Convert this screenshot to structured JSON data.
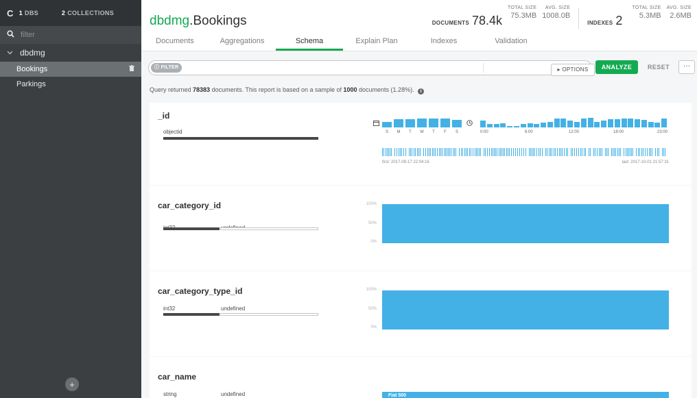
{
  "sidebar": {
    "db_count": "1",
    "db_label": "DBS",
    "coll_count": "2",
    "coll_label": "COLLECTIONS",
    "filter_placeholder": "filter",
    "database": "dbdmg",
    "collections": [
      {
        "name": "Bookings",
        "active": true
      },
      {
        "name": "Parkings",
        "active": false
      }
    ]
  },
  "header": {
    "db": "dbdmg",
    "collection": ".Bookings",
    "documents_label": "DOCUMENTS",
    "documents_value": "78.4k",
    "doc_total_size_label": "TOTAL SIZE",
    "doc_total_size": "75.3MB",
    "doc_avg_size_label": "AVG. SIZE",
    "doc_avg_size": "1008.0B",
    "indexes_label": "INDEXES",
    "indexes_value": "2",
    "idx_total_size_label": "TOTAL SIZE",
    "idx_total_size": "5.3MB",
    "idx_avg_size_label": "AVG. SIZE",
    "idx_avg_size": "2.6MB"
  },
  "tabs": [
    {
      "label": "Documents",
      "active": false
    },
    {
      "label": "Aggregations",
      "active": false
    },
    {
      "label": "Schema",
      "active": true
    },
    {
      "label": "Explain Plan",
      "active": false
    },
    {
      "label": "Indexes",
      "active": false
    },
    {
      "label": "Validation",
      "active": false
    }
  ],
  "querybar": {
    "filter_label": "FILTER",
    "options_label": "▸ OPTIONS",
    "analyze_label": "ANALYZE",
    "reset_label": "RESET",
    "more_label": "···"
  },
  "query_info": {
    "prefix": "Query returned ",
    "count": "78383",
    "middle": " documents. This report is based on a sample of ",
    "sample": "1000",
    "suffix": " documents (1.28%)."
  },
  "fields": [
    {
      "name": "_id",
      "types": [
        {
          "label": "objectid",
          "probability": 1.0
        }
      ],
      "day_labels": [
        "S",
        "M",
        "T",
        "W",
        "T",
        "F",
        "S"
      ],
      "day_values": [
        0.6,
        0.85,
        0.85,
        0.9,
        0.9,
        0.95,
        0.75
      ],
      "hour_labels": [
        "0:00",
        "6:00",
        "12:00",
        "18:00",
        "23:00"
      ],
      "hour_values": [
        0.7,
        0.35,
        0.35,
        0.45,
        0.15,
        0.15,
        0.35,
        0.45,
        0.35,
        0.5,
        0.55,
        0.9,
        0.95,
        0.7,
        0.6,
        0.9,
        1.0,
        0.6,
        0.7,
        0.85,
        0.85,
        0.9,
        0.9,
        0.85,
        0.75,
        0.6,
        0.5,
        0.9
      ],
      "first": "first: 2017-09-17 22:04:16",
      "last": "last: 2017-10-01 21:57:31"
    },
    {
      "name": "car_category_id",
      "types": [
        {
          "label": "int32",
          "probability": 1.0
        },
        {
          "label": "undefined",
          "probability": 0.0
        }
      ],
      "axis": [
        "100%",
        "50%",
        "0%"
      ],
      "fill": 1.0
    },
    {
      "name": "car_category_type_id",
      "types": [
        {
          "label": "int32",
          "probability": 1.0
        },
        {
          "label": "undefined",
          "probability": 0.0
        }
      ],
      "axis": [
        "100%",
        "50%",
        "0%"
      ],
      "fill": 1.0
    },
    {
      "name": "car_name",
      "types": [
        {
          "label": "string",
          "probability": 1.0
        },
        {
          "label": "undefined",
          "probability": 0.0
        }
      ],
      "bar_label": "Fiat 500"
    }
  ],
  "colors": {
    "accent": "#13aa52",
    "bar": "#43b1e5",
    "sidebar": "#3b3f42"
  }
}
